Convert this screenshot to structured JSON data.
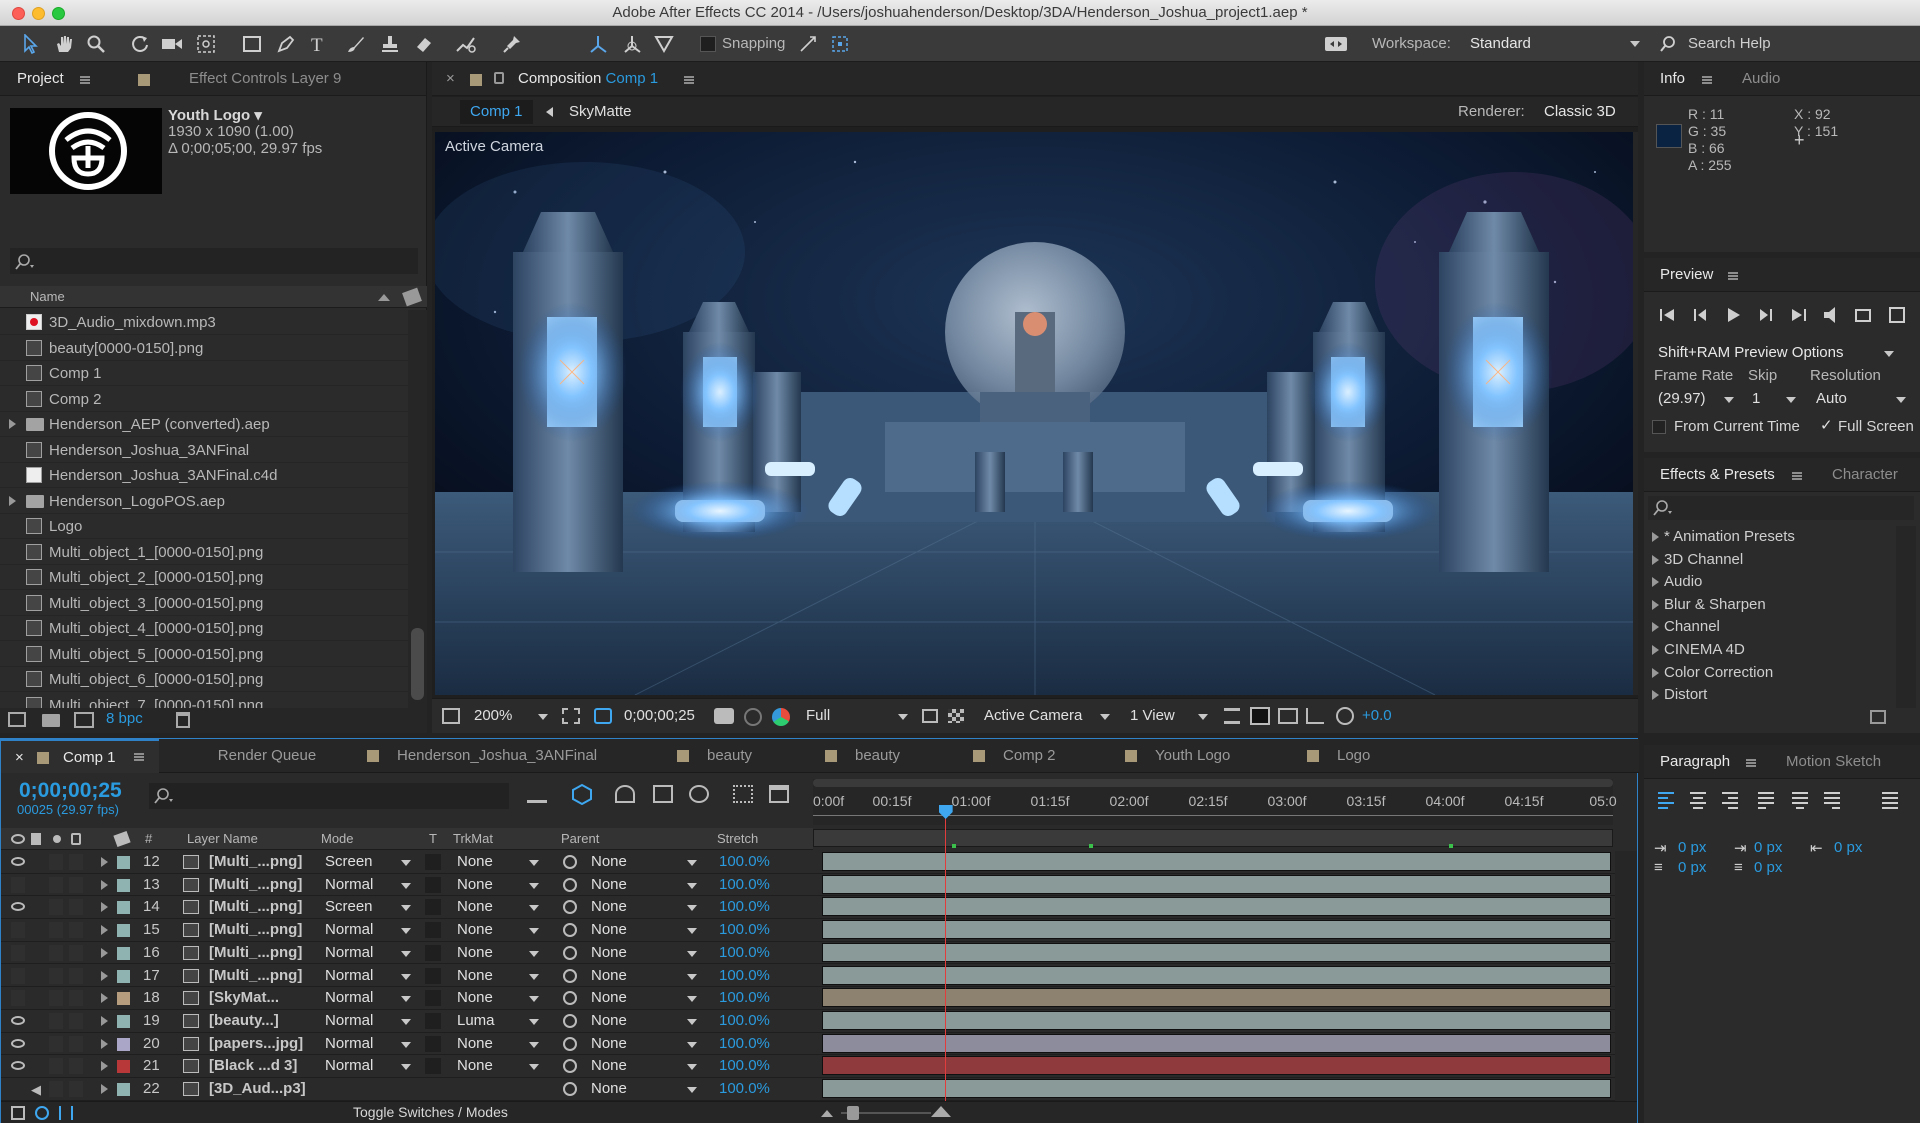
{
  "window": {
    "title": "Adobe After Effects CC 2014 - /Users/joshuahenderson/Desktop/3DA/Henderson_Joshua_project1.aep *"
  },
  "toolbar": {
    "snapping": "Snapping",
    "workspace_label": "Workspace:",
    "workspace_value": "Standard",
    "search_help": "Search Help"
  },
  "project": {
    "tabs": [
      "Project",
      "Effect Controls Layer 9"
    ],
    "thumb_name": "Youth Logo ▾",
    "thumb_dims": "1930 x 1090 (1.00)",
    "thumb_dur": "Δ 0;00;05;00, 29.97 fps",
    "col_name": "Name",
    "bpc": "8 bpc",
    "items": [
      {
        "name": "3D_Audio_mixdown.mp3",
        "icon": "audio-file-icon"
      },
      {
        "name": "beauty[0000-0150].png",
        "icon": "image-sequence-icon"
      },
      {
        "name": "Comp 1",
        "icon": "composition-icon"
      },
      {
        "name": "Comp 2",
        "icon": "composition-icon"
      },
      {
        "name": "Henderson_AEP (converted).aep",
        "icon": "folder-icon"
      },
      {
        "name": "Henderson_Joshua_3ANFinal",
        "icon": "composition-icon"
      },
      {
        "name": "Henderson_Joshua_3ANFinal.c4d",
        "icon": "c4d-file-icon"
      },
      {
        "name": "Henderson_LogoPOS.aep",
        "icon": "folder-icon"
      },
      {
        "name": "Logo",
        "icon": "composition-icon"
      },
      {
        "name": "Multi_object_1_[0000-0150].png",
        "icon": "image-sequence-icon"
      },
      {
        "name": "Multi_object_2_[0000-0150].png",
        "icon": "image-sequence-icon"
      },
      {
        "name": "Multi_object_3_[0000-0150].png",
        "icon": "image-sequence-icon"
      },
      {
        "name": "Multi_object_4_[0000-0150].png",
        "icon": "image-sequence-icon"
      },
      {
        "name": "Multi_object_5_[0000-0150].png",
        "icon": "image-sequence-icon"
      },
      {
        "name": "Multi_object_6_[0000-0150].png",
        "icon": "image-sequence-icon"
      },
      {
        "name": "Multi_object_7_[0000-0150].png",
        "icon": "image-sequence-icon"
      }
    ]
  },
  "composition": {
    "tab_prefix": "Composition",
    "tab_name": "Comp 1",
    "crumb_active": "Comp 1",
    "crumb_next": "SkyMatte",
    "renderer_label": "Renderer:",
    "renderer_value": "Classic 3D",
    "viewer_label": "Active Camera",
    "footer": {
      "zoom": "200%",
      "timecode": "0;00;00;25",
      "resolution": "Full",
      "camera": "Active Camera",
      "views": "1 View",
      "exposure": "+0.0"
    }
  },
  "info": {
    "tabs": [
      "Info",
      "Audio"
    ],
    "r": "R : 11",
    "g": "G : 35",
    "b": "B : 66",
    "a": "A : 255",
    "x": "X : 92",
    "y": "Y : 151",
    "swatch": "#0b2342"
  },
  "preview": {
    "title": "Preview",
    "options": "Shift+RAM Preview Options",
    "frame_rate_label": "Frame Rate",
    "skip_label": "Skip",
    "resolution_label": "Resolution",
    "frame_rate": "(29.97)",
    "skip": "1",
    "resolution": "Auto",
    "from_current": "From Current Time",
    "full_screen": "Full Screen"
  },
  "effects": {
    "tabs": [
      "Effects & Presets",
      "Character"
    ],
    "items": [
      "* Animation Presets",
      "3D Channel",
      "Audio",
      "Blur & Sharpen",
      "Channel",
      "CINEMA 4D",
      "Color Correction",
      "Distort"
    ]
  },
  "paragraph": {
    "tabs": [
      "Paragraph",
      "Motion Sketch"
    ],
    "indent_left": "0 px",
    "indent_first": "0 px",
    "indent_right": "0 px",
    "space_before": "0 px",
    "space_after": "0 px"
  },
  "timeline": {
    "tabs": [
      {
        "label": "Comp 1",
        "color": "#a89a78"
      },
      {
        "label": "Render Queue",
        "color": ""
      },
      {
        "label": "Henderson_Joshua_3ANFinal",
        "color": "#a89a78"
      },
      {
        "label": "beauty",
        "color": "#a89a78"
      },
      {
        "label": "beauty",
        "color": "#a89a78"
      },
      {
        "label": "Comp 2",
        "color": "#a89a78"
      },
      {
        "label": "Youth Logo",
        "color": "#a89a78"
      },
      {
        "label": "Logo",
        "color": "#a89a78"
      }
    ],
    "timecode": "0;00;00;25",
    "frame_info": "00025 (29.97 fps)",
    "columns": {
      "num": "#",
      "layer_name": "Layer Name",
      "mode": "Mode",
      "t": "T",
      "trkmat": "TrkMat",
      "parent": "Parent",
      "stretch": "Stretch"
    },
    "ruler": [
      "0:00f",
      "00:15f",
      "01:00f",
      "01:15f",
      "02:00f",
      "02:15f",
      "03:00f",
      "03:15f",
      "04:00f",
      "04:15f",
      "05:0"
    ],
    "playhead_frame": 25,
    "duration_frames": 150,
    "layers": [
      {
        "num": "12",
        "name": "[Multi_...png]",
        "mode": "Screen",
        "trkmat": "None",
        "parent": "None",
        "stretch": "100.0%",
        "label_color": "#8fb3b0",
        "bar_color": "#8a9a98",
        "eye": true
      },
      {
        "num": "13",
        "name": "[Multi_...png]",
        "mode": "Normal",
        "trkmat": "None",
        "parent": "None",
        "stretch": "100.0%",
        "label_color": "#8fb3b0",
        "bar_color": "#8a9a98",
        "eye": false
      },
      {
        "num": "14",
        "name": "[Multi_...png]",
        "mode": "Screen",
        "trkmat": "None",
        "parent": "None",
        "stretch": "100.0%",
        "label_color": "#8fb3b0",
        "bar_color": "#8a9a98",
        "eye": true
      },
      {
        "num": "15",
        "name": "[Multi_...png]",
        "mode": "Normal",
        "trkmat": "None",
        "parent": "None",
        "stretch": "100.0%",
        "label_color": "#8fb3b0",
        "bar_color": "#8a9a98",
        "eye": false
      },
      {
        "num": "16",
        "name": "[Multi_...png]",
        "mode": "Normal",
        "trkmat": "None",
        "parent": "None",
        "stretch": "100.0%",
        "label_color": "#8fb3b0",
        "bar_color": "#8a9a98",
        "eye": false
      },
      {
        "num": "17",
        "name": "[Multi_...png]",
        "mode": "Normal",
        "trkmat": "None",
        "parent": "None",
        "stretch": "100.0%",
        "label_color": "#8fb3b0",
        "bar_color": "#8a9a98",
        "eye": false
      },
      {
        "num": "18",
        "name": "[SkyMat...",
        "mode": "Normal",
        "trkmat": "None",
        "parent": "None",
        "stretch": "100.0%",
        "label_color": "#b59d7e",
        "bar_color": "#8d8170",
        "eye": false
      },
      {
        "num": "19",
        "name": "[beauty...]",
        "mode": "Normal",
        "trkmat": "Luma",
        "parent": "None",
        "stretch": "100.0%",
        "label_color": "#8fb3b0",
        "bar_color": "#8a9a98",
        "eye": true
      },
      {
        "num": "20",
        "name": "[papers...jpg]",
        "mode": "Normal",
        "trkmat": "None",
        "parent": "None",
        "stretch": "100.0%",
        "label_color": "#a9a6c8",
        "bar_color": "#8d8c9c",
        "eye": true
      },
      {
        "num": "21",
        "name": "[Black ...d 3]",
        "mode": "Normal",
        "trkmat": "None",
        "parent": "None",
        "stretch": "100.0%",
        "label_color": "#b8383a",
        "bar_color": "#8f3a3d",
        "eye": true
      },
      {
        "num": "22",
        "name": "[3D_Aud...p3]",
        "mode": "",
        "trkmat": "",
        "parent": "None",
        "stretch": "100.0%",
        "label_color": "#8fb3b0",
        "bar_color": "#8a9a98",
        "eye": false
      }
    ],
    "footer": "Toggle Switches / Modes"
  }
}
